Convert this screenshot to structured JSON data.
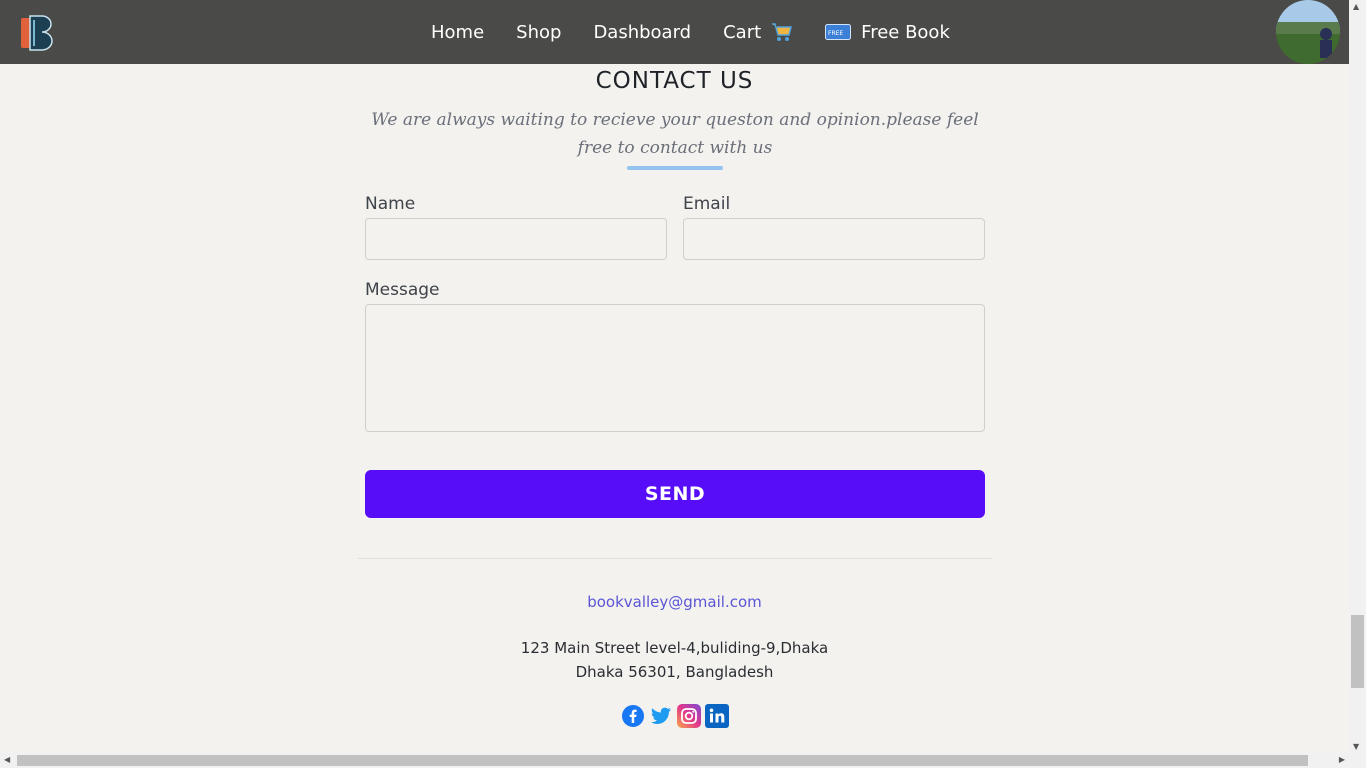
{
  "nav": {
    "items": [
      "Home",
      "Shop",
      "Dashboard",
      "Cart",
      "Free Book"
    ],
    "cart_icon": "shopping-cart-icon",
    "free_icon": "free-tag-icon",
    "logo_icon": "book-valley-logo",
    "bg_color": "#4a4a48"
  },
  "contact": {
    "title": "CONTACT US",
    "subtitle": "We are always waiting to recieve your queston and opinion.please feel free to contact with us",
    "name_label": "Name",
    "name_value": "",
    "email_label": "Email",
    "email_value": "",
    "message_label": "Message",
    "message_value": "",
    "send_label": "SEND",
    "accent_color": "#570df8",
    "underline_color": "#93c2f0"
  },
  "footer": {
    "email": "bookvalley@gmail.com",
    "address_line1": "123 Main Street level-4,buliding-9,Dhaka",
    "address_line2": "Dhaka 56301, Bangladesh",
    "socials": [
      "facebook-icon",
      "twitter-icon",
      "instagram-icon",
      "linkedin-icon"
    ]
  }
}
